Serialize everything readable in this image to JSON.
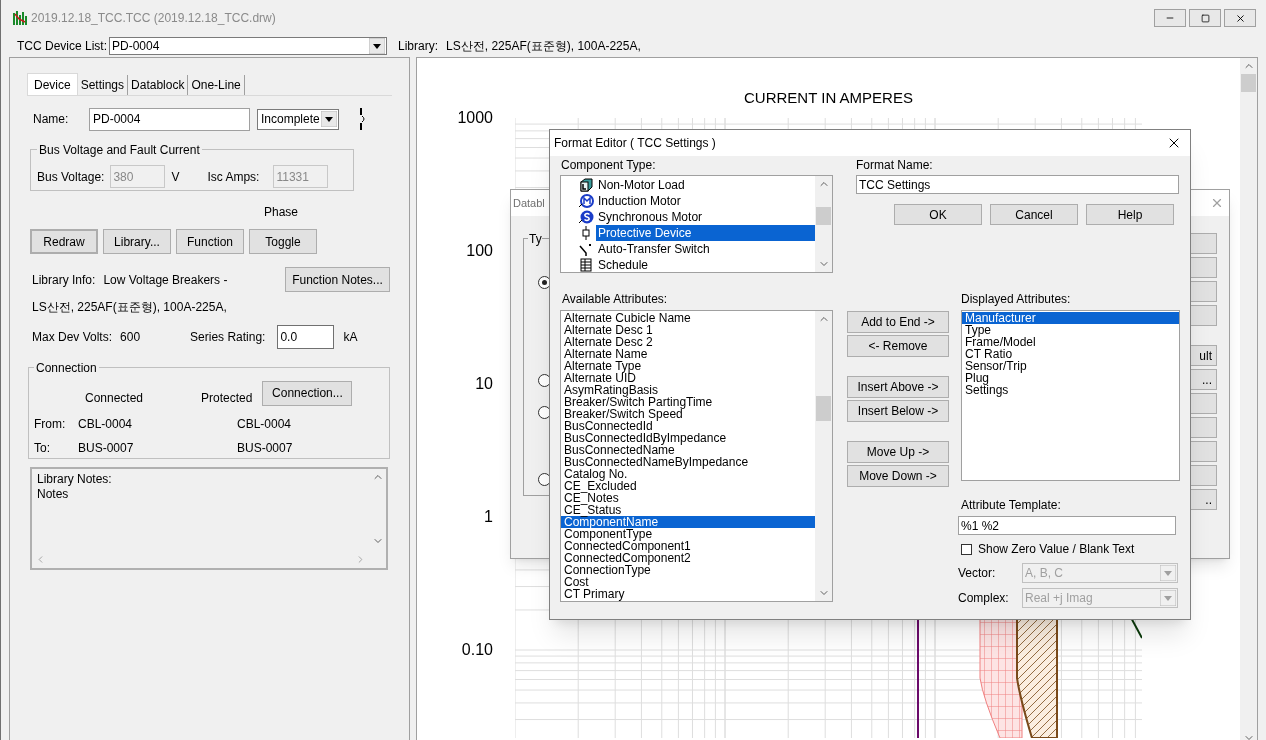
{
  "window": {
    "title": "2019.12.18_TCC.TCC (2019.12.18_TCC.drw)"
  },
  "device_bar": {
    "label": "TCC Device List:",
    "value": "PD-0004",
    "library_label": "Library:",
    "library_value": "LS산전, 225AF(표준형), 100A-225A,"
  },
  "left_panel": {
    "tabs": [
      {
        "label": "Device",
        "selected": true
      },
      {
        "label": "Settings",
        "selected": false
      },
      {
        "label": "Datablock",
        "selected": false
      },
      {
        "label": "One-Line",
        "selected": false
      }
    ],
    "name_label": "Name:",
    "name_value": "PD-0004",
    "status_value": "Incomplete",
    "bus_group": {
      "title": "Bus Voltage and Fault Current",
      "voltage_label": "Bus Voltage:",
      "voltage_value": "380",
      "voltage_unit": "V",
      "isc_label": "Isc Amps:",
      "isc_value": "11331"
    },
    "phase_label": "Phase",
    "buttons": [
      "Redraw",
      "Library...",
      "Function",
      "Toggle"
    ],
    "library_info_label": "Library Info:",
    "library_info_value": "Low Voltage Breakers -",
    "library_info_line2": "LS산전, 225AF(표준형), 100A-225A,",
    "function_notes_button": "Function Notes...",
    "max_dev_label": "Max Dev Volts:",
    "max_dev_value": "600",
    "series_label": "Series Rating:",
    "series_value": "0.0",
    "series_unit": "kA",
    "connection": {
      "title": "Connection",
      "connected_header": "Connected",
      "protected_header": "Protected",
      "button": "Connection...",
      "rows": [
        {
          "label": "From:",
          "connected": "CBL-0004",
          "protected": "CBL-0004"
        },
        {
          "label": "To:",
          "connected": "BUS-0007",
          "protected": "BUS-0007"
        }
      ]
    },
    "notes": [
      "Library Notes:",
      "Notes"
    ]
  },
  "plot": {
    "title": "CURRENT IN AMPERES",
    "y_labels": [
      "1000",
      "100",
      "10",
      "1",
      "0.10"
    ]
  },
  "datablock_dialog": {
    "title": "Databl",
    "group_label": "Ty",
    "radios": [
      {
        "selected": true
      },
      {
        "selected": false
      },
      {
        "selected": false
      },
      {
        "selected": false
      }
    ],
    "side_buttons": [
      {
        "label": "ult"
      },
      {
        "label": "..."
      },
      {
        "label": ".."
      }
    ]
  },
  "format_editor": {
    "title": "Format Editor ( TCC Settings )",
    "component_type_label": "Component Type:",
    "component_types": [
      {
        "label": "Non-Motor Load",
        "kind": "load",
        "selected": false
      },
      {
        "label": "Induction Motor",
        "kind": "induction",
        "selected": false
      },
      {
        "label": "Synchronous Motor",
        "kind": "synchronous",
        "selected": false
      },
      {
        "label": "Protective Device",
        "kind": "protective",
        "selected": true
      },
      {
        "label": "Auto-Transfer Switch",
        "kind": "switch",
        "selected": false
      },
      {
        "label": "Schedule",
        "kind": "schedule",
        "selected": false
      }
    ],
    "format_name_label": "Format Name:",
    "format_name_value": "TCC Settings",
    "dialog_buttons": [
      "OK",
      "Cancel",
      "Help"
    ],
    "available_label": "Available Attributes:",
    "available": [
      {
        "label": "Alternate Cubicle Name",
        "selected": false
      },
      {
        "label": "Alternate Desc 1",
        "selected": false
      },
      {
        "label": "Alternate Desc 2",
        "selected": false
      },
      {
        "label": "Alternate Name",
        "selected": false
      },
      {
        "label": "Alternate Type",
        "selected": false
      },
      {
        "label": "Alternate UID",
        "selected": false
      },
      {
        "label": "AsymRatingBasis",
        "selected": false
      },
      {
        "label": "Breaker/Switch PartingTime",
        "selected": false
      },
      {
        "label": "Breaker/Switch Speed",
        "selected": false
      },
      {
        "label": "BusConnectedId",
        "selected": false
      },
      {
        "label": "BusConnectedIdByImpedance",
        "selected": false
      },
      {
        "label": "BusConnectedName",
        "selected": false
      },
      {
        "label": "BusConnectedNameByImpedance",
        "selected": false
      },
      {
        "label": "Catalog No.",
        "selected": false
      },
      {
        "label": "CE_Excluded",
        "selected": false
      },
      {
        "label": "CE_Notes",
        "selected": false
      },
      {
        "label": "CE_Status",
        "selected": false
      },
      {
        "label": "ComponentName",
        "selected": true
      },
      {
        "label": "ComponentType",
        "selected": false
      },
      {
        "label": "ConnectedComponent1",
        "selected": false
      },
      {
        "label": "ConnectedComponent2",
        "selected": false
      },
      {
        "label": "ConnectionType",
        "selected": false
      },
      {
        "label": "Cost",
        "selected": false
      },
      {
        "label": "CT Primary",
        "selected": false
      }
    ],
    "action_buttons": [
      "Add to End ->",
      "<- Remove",
      "Insert Above ->",
      "Insert Below ->",
      "Move Up ->",
      "Move Down ->"
    ],
    "displayed_label": "Displayed Attributes:",
    "displayed": [
      {
        "label": "Manufacturer",
        "selected": true
      },
      {
        "label": "Type",
        "selected": false
      },
      {
        "label": "Frame/Model",
        "selected": false
      },
      {
        "label": "CT Ratio",
        "selected": false
      },
      {
        "label": "Sensor/Trip",
        "selected": false
      },
      {
        "label": "Plug",
        "selected": false
      },
      {
        "label": "Settings",
        "selected": false
      }
    ],
    "template_label": "Attribute Template:",
    "template_value": "%1 %2",
    "show_zero": {
      "label": "Show Zero Value / Blank Text",
      "checked": false
    },
    "vector": {
      "label": "Vector:",
      "value": "A, B, C",
      "disabled": true
    },
    "complex": {
      "label": "Complex:",
      "value": "Real +j Imag",
      "disabled": true
    }
  }
}
